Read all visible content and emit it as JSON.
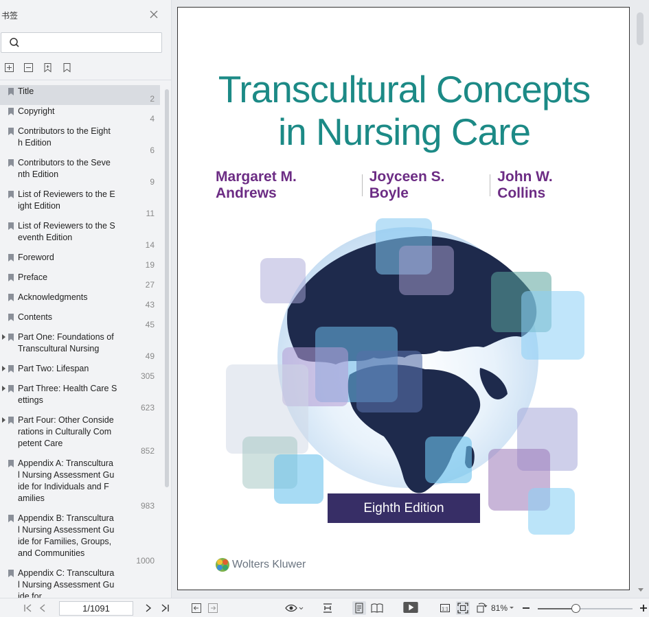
{
  "sidebar": {
    "title": "书签",
    "search": {
      "placeholder": "",
      "value": ""
    },
    "bookmarks": [
      {
        "label": "Title",
        "page": "2",
        "active": true,
        "expandable": false
      },
      {
        "label": "Copyright",
        "page": "4",
        "active": false,
        "expandable": false
      },
      {
        "label": "Contributors to the Eight\nh Edition",
        "page": "6",
        "active": false,
        "expandable": false
      },
      {
        "label": "Contributors to the Seve\nnth Edition",
        "page": "9",
        "active": false,
        "expandable": false
      },
      {
        "label": "List of Reviewers to the E\night Edition",
        "page": "11",
        "active": false,
        "expandable": false
      },
      {
        "label": "List of Reviewers to the S\neventh Edition",
        "page": "14",
        "active": false,
        "expandable": false
      },
      {
        "label": "Foreword",
        "page": "19",
        "active": false,
        "expandable": false
      },
      {
        "label": "Preface",
        "page": "27",
        "active": false,
        "expandable": false
      },
      {
        "label": "Acknowledgments",
        "page": "43",
        "active": false,
        "expandable": false
      },
      {
        "label": "Contents",
        "page": "45",
        "active": false,
        "expandable": false
      },
      {
        "label": "Part One: Foundations of\nTranscultural Nursing",
        "page": "49",
        "active": false,
        "expandable": true
      },
      {
        "label": "Part Two: Lifespan",
        "page": "305",
        "active": false,
        "expandable": true
      },
      {
        "label": "Part Three: Health Care S\nettings",
        "page": "623",
        "active": false,
        "expandable": true
      },
      {
        "label": "Part Four: Other Conside\nrations in Culturally Com\npetent Care",
        "page": "852",
        "active": false,
        "expandable": true
      },
      {
        "label": "Appendix A: Transcultura\nl Nursing Assessment Gu\nide for Individuals and F\namilies",
        "page": "983",
        "active": false,
        "expandable": false
      },
      {
        "label": "Appendix B: Transcultura\nl Nursing Assessment Gu\nide for Families, Groups,\nand Communities",
        "page": "1000",
        "active": false,
        "expandable": false
      },
      {
        "label": "Appendix C: Transcultura\nl Nursing Assessment Gu\nide for ...",
        "page": "",
        "active": false,
        "expandable": false
      }
    ]
  },
  "document": {
    "title_line1": "Transcultural Concepts",
    "title_line2": "in Nursing Care",
    "authors": [
      "Margaret M. Andrews",
      "Joyceen S. Boyle",
      "John W. Collins"
    ],
    "edition": "Eighth Edition",
    "publisher": "Wolters Kluwer"
  },
  "statusbar": {
    "page_indicator": "1/1091",
    "zoom": "81%"
  },
  "colors": {
    "title": "#1c8a86",
    "authors": "#6c2c84",
    "edition_bg": "#372e66",
    "globe_dark": "#1e2a4c"
  }
}
